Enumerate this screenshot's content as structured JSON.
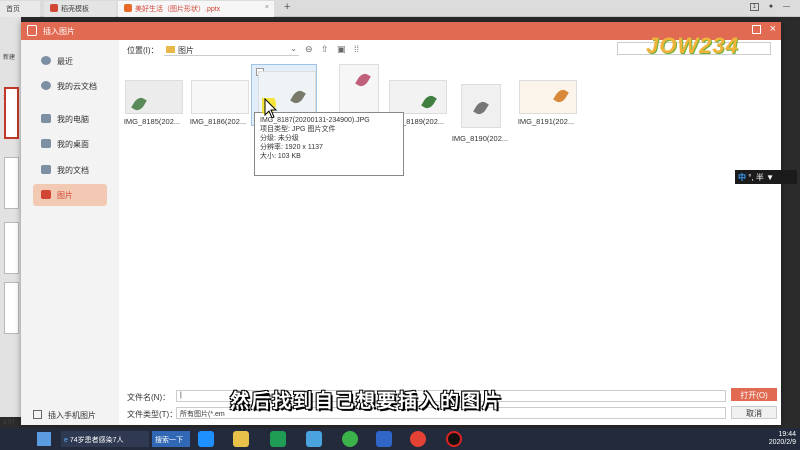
{
  "tabs": [
    {
      "label": "首页"
    },
    {
      "label": "稻壳模板"
    },
    {
      "label": "美好生活（图片形状）.pptx"
    }
  ],
  "tab_plus": "+",
  "topbar_badge": "1",
  "left_strip": {
    "new_label": "新建",
    "slide_no": "1",
    "view_label": "幻灯"
  },
  "dialog": {
    "title": "插入图片",
    "sidebar": [
      {
        "label": "最近"
      },
      {
        "label": "我的云文档"
      },
      {
        "label": "我的电脑"
      },
      {
        "label": "我的桌面"
      },
      {
        "label": "我的文档"
      },
      {
        "label": "图片",
        "active": true
      }
    ],
    "phone_import": "插入手机图片",
    "location_label": "位置(I)：",
    "location_value": "图片",
    "files": [
      {
        "name": "IMG_8185(202..."
      },
      {
        "name": "IMG_8186(202..."
      },
      {
        "name": "IMG_8187",
        "selected": true
      },
      {
        "name": ""
      },
      {
        "name": "IMG_8189(202..."
      },
      {
        "name": "IMG_8190(202..."
      },
      {
        "name": "IMG_8191(202..."
      }
    ],
    "tooltip": {
      "line1": "IMG_8187(20200131-234900).JPG",
      "line2": "项目类型: JPG 图片文件",
      "line3": "分级: 未分级",
      "line4": "分辨率: 1920 x 1137",
      "line5": "大小: 103 KB"
    },
    "filename_label": "文件名(N)：",
    "filename_value": "|",
    "filetype_label": "文件类型(T)：",
    "filetype_value": "所有图片(*.em",
    "open_button": "打开(O)",
    "cancel_button": "取消"
  },
  "caption": "然后找到自己想要插入的图片",
  "watermark": "JOW234",
  "ime": {
    "mode": "中",
    "punct": "°, 半"
  },
  "taskbar": {
    "news": "74岁患者感染7人",
    "search": "搜索一下",
    "time": "19:44",
    "date": "2020/2/9"
  },
  "colors": {
    "accent": "#e06a52",
    "active_nav_bg": "#f2c9b3"
  }
}
